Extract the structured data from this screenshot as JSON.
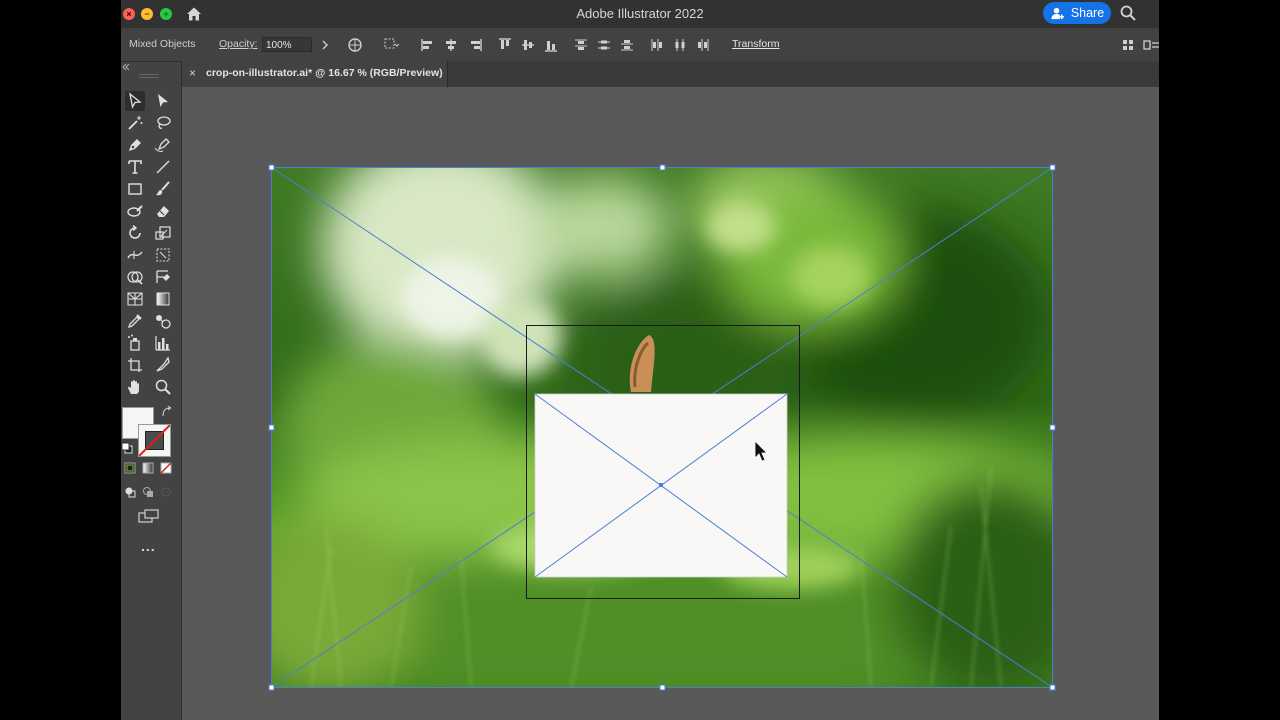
{
  "window": {
    "title": "Adobe Illustrator 2022",
    "share_label": "Share"
  },
  "controlbar": {
    "selection_label": "Mixed Objects",
    "opacity_label": "Opacity:",
    "opacity_value": "100%",
    "transform_label": "Transform"
  },
  "document": {
    "tab_close": "×",
    "tab_title": "crop-on-illustrator.ai* @ 16.67 % (RGB/Preview)"
  },
  "toolbar": {
    "more_label": "..."
  },
  "colors": {
    "accent": "#1473e6",
    "selection": "#4a7fd6",
    "chrome_dark": "#323232",
    "panel": "#434343",
    "canvas": "#595959"
  }
}
